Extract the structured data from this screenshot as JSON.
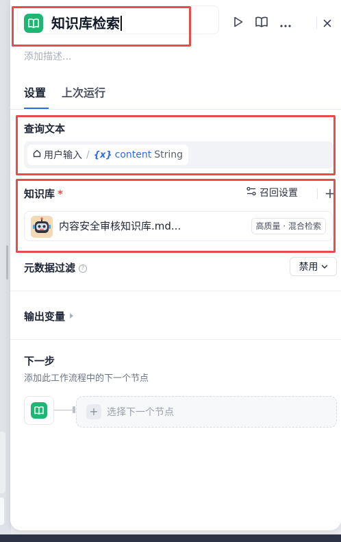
{
  "header": {
    "title": "知识库检索",
    "icons": {
      "app": "book-open-icon",
      "run": "play-icon",
      "help": "book-icon",
      "more": "more-horizontal-icon",
      "close": "close-icon"
    }
  },
  "description_placeholder": "添加描述...",
  "tabs": [
    {
      "label": "设置",
      "active": true
    },
    {
      "label": "上次运行",
      "active": false
    }
  ],
  "query": {
    "label": "查询文本",
    "source": "用户输入",
    "separator": "/",
    "var_symbol": "{x}",
    "var_name": "content",
    "var_type": "String"
  },
  "knowledge": {
    "label": "知识库",
    "required_mark": "*",
    "recall_settings": "召回设置",
    "add": "+",
    "items": [
      {
        "name": "内容安全审核知识库.md...",
        "badge": "高质量 · 混合检索"
      }
    ]
  },
  "metadata_filter": {
    "label": "元数据过滤",
    "help": "?",
    "value": "禁用"
  },
  "output_vars": {
    "label": "输出变量"
  },
  "next_step": {
    "label": "下一步",
    "description": "添加此工作流程中的下一个节点",
    "plus": "+",
    "select": "选择下一个节点"
  },
  "colors": {
    "accent": "#2a6be8",
    "app_icon": "#1fb572",
    "highlight": "#e94a4a",
    "required": "#e94a4a"
  }
}
